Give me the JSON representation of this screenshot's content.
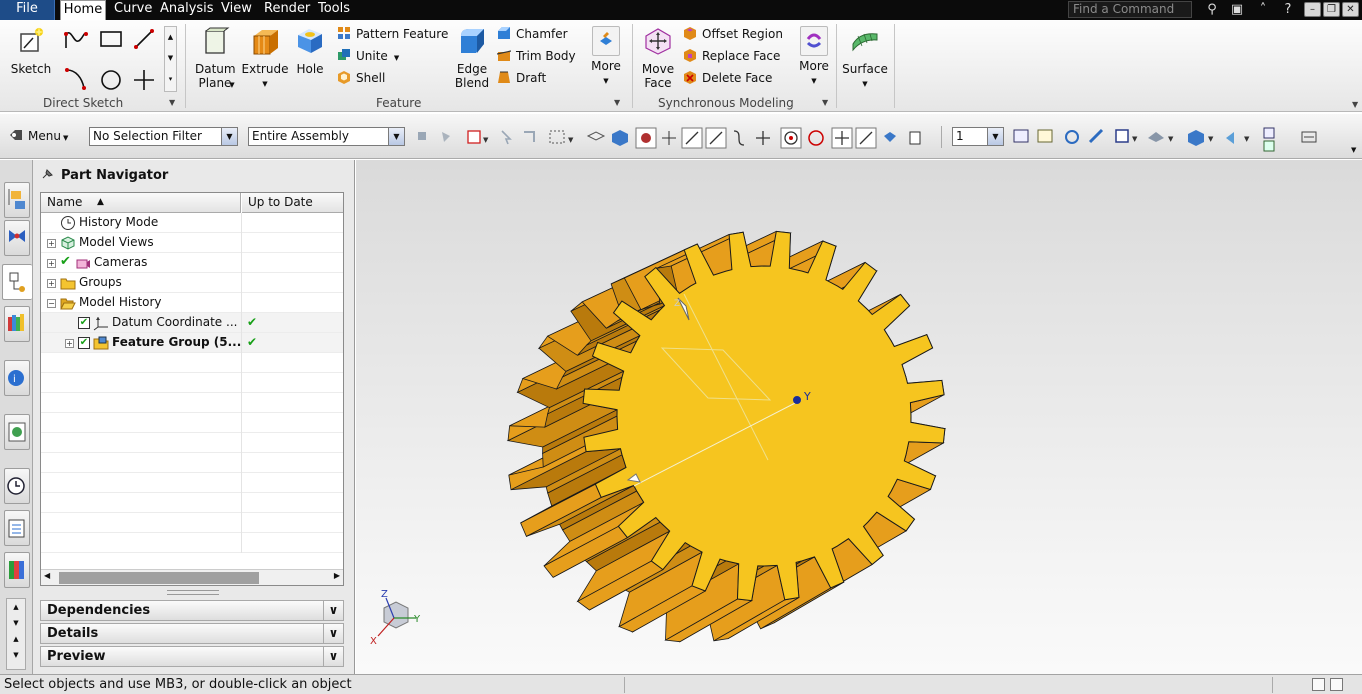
{
  "menubar": {
    "tabs": [
      "File",
      "Home",
      "Curve",
      "Analysis",
      "View",
      "Render",
      "Tools"
    ],
    "find_placeholder": "Find a Command"
  },
  "ribbon": {
    "direct_sketch": {
      "sketch_label": "Sketch",
      "group_label": "Direct Sketch"
    },
    "feature": {
      "datum_plane_label": "Datum Plane",
      "extrude_label": "Extrude",
      "hole_label": "Hole",
      "pattern_feature_label": "Pattern Feature",
      "unite_label": "Unite",
      "shell_label": "Shell",
      "edge_blend_label": "Edge Blend",
      "chamfer_label": "Chamfer",
      "trim_body_label": "Trim Body",
      "draft_label": "Draft",
      "more_label": "More",
      "group_label": "Feature"
    },
    "synchronous": {
      "move_face_label": "Move Face",
      "offset_region_label": "Offset Region",
      "replace_face_label": "Replace Face",
      "delete_face_label": "Delete Face",
      "more_label": "More",
      "group_label": "Synchronous Modeling"
    },
    "surface_label": "Surface"
  },
  "toolbar": {
    "menu_label": "Menu",
    "selection_filter": "No Selection Filter",
    "assembly_scope": "Entire Assembly",
    "layer_value": "1"
  },
  "navigator": {
    "title": "Part Navigator",
    "columns": [
      "Name",
      "Up to Date"
    ],
    "rows": [
      {
        "label": "History Mode",
        "icon": "clock-icon",
        "status": ""
      },
      {
        "label": "Model Views",
        "icon": "model-views-icon",
        "status": ""
      },
      {
        "label": "Cameras",
        "icon": "camera-icon",
        "status": ""
      },
      {
        "label": "Groups",
        "icon": "folder-icon",
        "status": ""
      },
      {
        "label": "Model History",
        "icon": "folder-open-icon",
        "status": ""
      },
      {
        "label": "Datum Coordinate ...",
        "icon": "datum-csys-icon",
        "status": "✔"
      },
      {
        "label": "Feature Group (5...",
        "icon": "feature-group-icon",
        "status": "✔"
      }
    ],
    "panels": [
      "Dependencies",
      "Details",
      "Preview"
    ]
  },
  "viewport": {
    "gear_teeth": 24,
    "face_color": "#f6c51f",
    "side_color": "#cf8d14",
    "triad_y_label": "Y",
    "triad_z_label": "Z",
    "view_triad": {
      "x": "X",
      "y": "Y",
      "z": "Z"
    }
  },
  "status": {
    "message": "Select objects and use MB3, or double-click an object"
  }
}
